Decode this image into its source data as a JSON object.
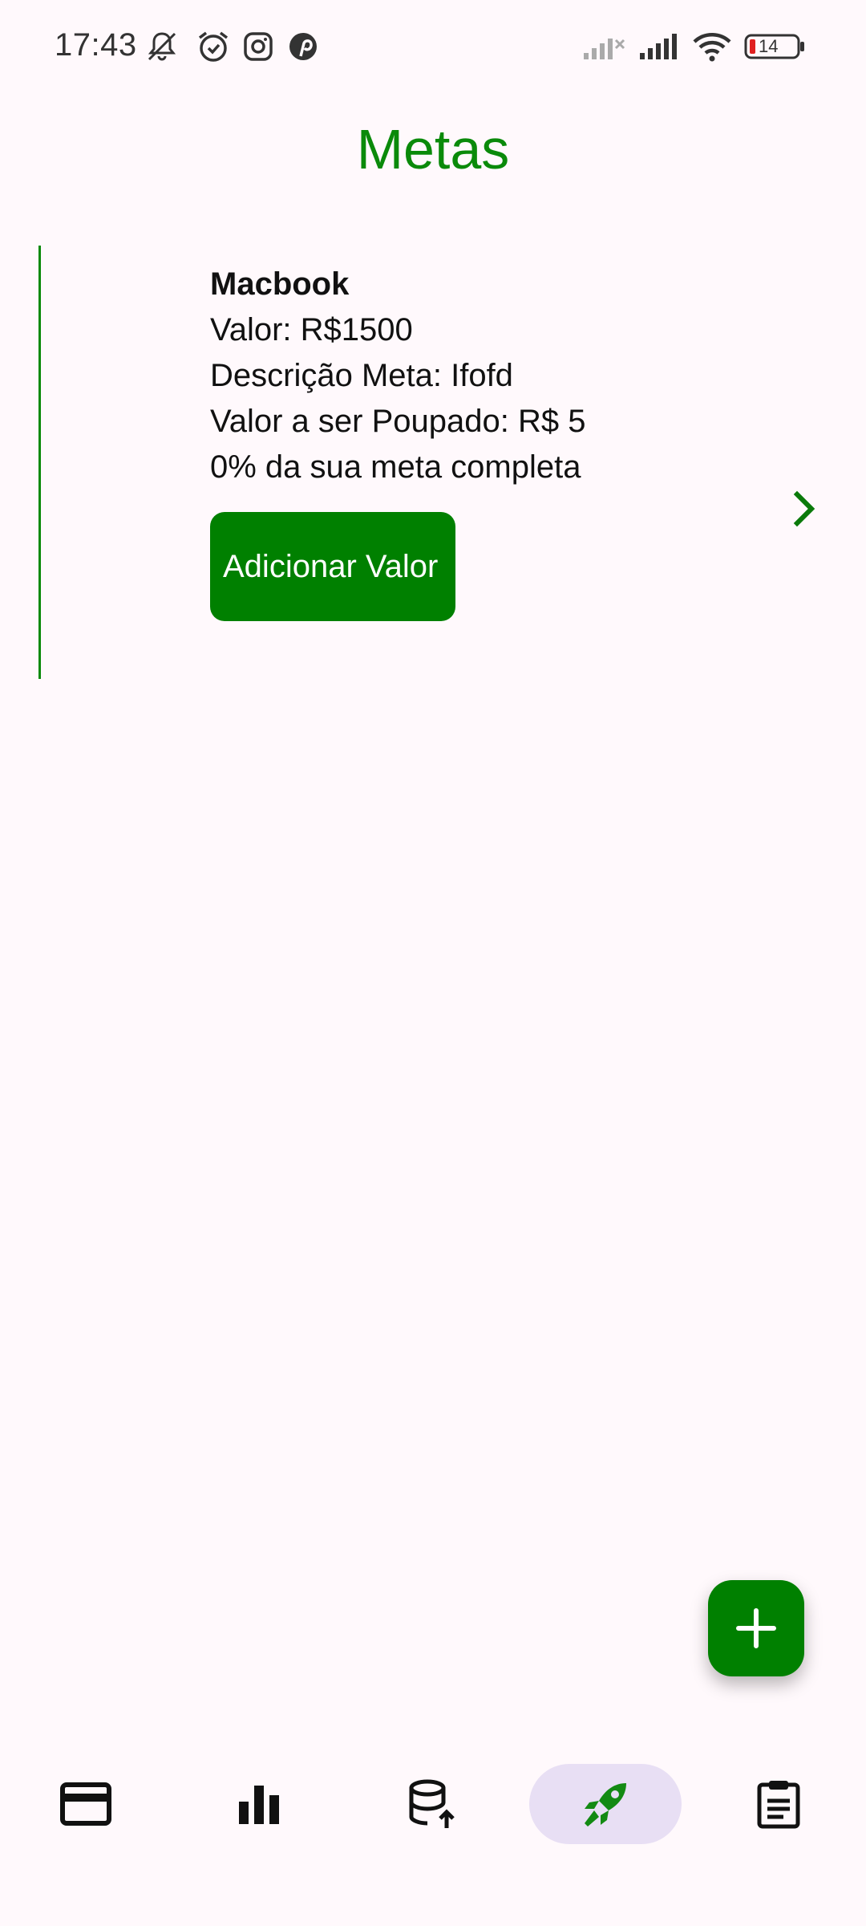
{
  "status_bar": {
    "time": "17:43",
    "battery_level": "14",
    "icons": [
      "mute-notifications-icon",
      "alarm-icon",
      "instagram-icon",
      "pinterest-icon",
      "signal-no-sim-icon",
      "signal-icon",
      "wifi-icon",
      "battery-icon"
    ]
  },
  "page": {
    "title": "Metas"
  },
  "goals": [
    {
      "name": "Macbook",
      "value_line": "Valor: R$1500",
      "description_line": "Descrição Meta: Ifofd",
      "savings_line": "Valor a ser Poupado: R$ 5",
      "progress_line": "0% da sua meta completa",
      "progress_fraction": 0,
      "button_label": "Adicionar Valor",
      "accent_color": "#0A8A0A"
    }
  ],
  "fab": {
    "icon": "plus-icon",
    "color": "#008000"
  },
  "bottom_nav": {
    "items": [
      {
        "icon": "credit-card-icon",
        "active": false
      },
      {
        "icon": "bar-chart-icon",
        "active": false
      },
      {
        "icon": "database-upload-icon",
        "active": false
      },
      {
        "icon": "rocket-icon",
        "active": true
      },
      {
        "icon": "clipboard-icon",
        "active": false
      }
    ],
    "active_pill_color": "#E8DFF4"
  }
}
